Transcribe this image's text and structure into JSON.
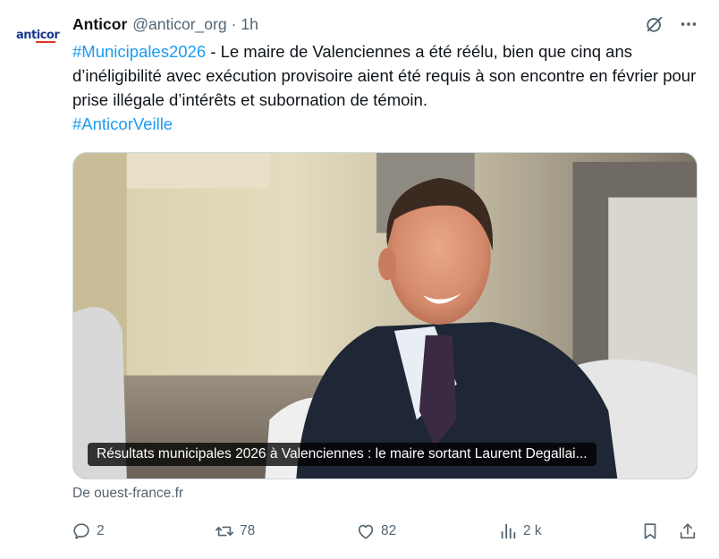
{
  "author": {
    "name": "Anticor",
    "handle": "@anticor_org",
    "separator": "·",
    "time": "1h",
    "avatar_text": "anticor"
  },
  "tweet": {
    "hashtag1": "#Municipales2026",
    "body": " - Le maire de Valenciennes a été réélu, bien que cinq ans d’inéligibilité avec exécution provisoire aient été requis à son encontre en février pour prise illégale d’intérêts et subornation de témoin.",
    "hashtag2": "#AnticorVeille"
  },
  "card": {
    "title": "Résultats municipales 2026 à Valenciennes : le maire sortant Laurent Degallai...",
    "source": "De ouest-france.fr"
  },
  "actions": {
    "replies": "2",
    "reposts": "78",
    "likes": "82",
    "views": "2 k"
  },
  "icons": {
    "grok": "grok-icon",
    "more": "more-icon",
    "reply": "reply-icon",
    "repost": "repost-icon",
    "like": "heart-icon",
    "views": "analytics-icon",
    "bookmark": "bookmark-icon",
    "share": "share-icon"
  },
  "colors": {
    "link": "#1d9bf0",
    "text": "#0f1419",
    "secondary": "#536471",
    "brand_blue": "#1a3a8c",
    "brand_red": "#e0342b"
  }
}
